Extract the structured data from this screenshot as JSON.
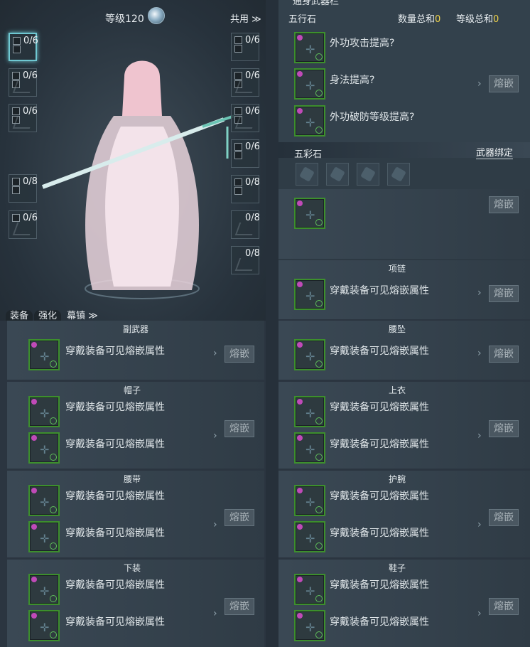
{
  "character_panel": {
    "level_label": "等级120",
    "shared_label": "共用 ≫",
    "left_slots": [
      "0/6",
      "0/6",
      "0/6",
      "0/8",
      "0/6"
    ],
    "right_slots": [
      "0/6",
      "0/6",
      "0/6",
      "0/6",
      "0/8",
      "0/8",
      "0/8"
    ],
    "tabs": [
      "装备",
      "强化",
      "幕镇 ≫"
    ]
  },
  "weapon_section": {
    "partial_header": "通身武器栏",
    "five_elements": {
      "title": "五行石",
      "quantity_label": "数量总和",
      "quantity_value": "0",
      "level_label": "等级总和",
      "level_value": "0",
      "slots": [
        "外功攻击提高?",
        "身法提高?",
        "外功破防等级提高?"
      ],
      "inlay_button": "熔嵌"
    },
    "colored_stone": {
      "title": "五彩石",
      "bind_label": "武器绑定",
      "inlay_button": "熔嵌"
    }
  },
  "equip_text": "穿戴装备可见熔嵌属性",
  "inlay_label": "熔嵌",
  "sections": {
    "secondary_weapon": "副武器",
    "necklace": "项链",
    "pendant": "腰坠",
    "hat": "帽子",
    "top": "上衣",
    "belt": "腰带",
    "bracer": "护腕",
    "pants": "下装",
    "shoes": "鞋子"
  },
  "colors": {
    "accent_yellow": "#f0d34a",
    "gem_border": "#3d8f2d",
    "slot_highlight": "#6fc8d2"
  }
}
